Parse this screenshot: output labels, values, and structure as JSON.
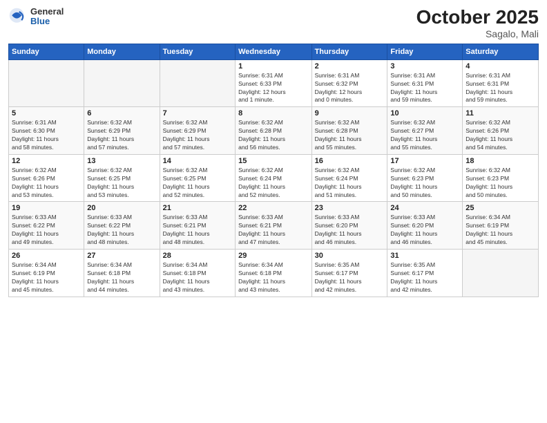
{
  "header": {
    "logo_general": "General",
    "logo_blue": "Blue",
    "month_title": "October 2025",
    "location": "Sagalo, Mali"
  },
  "weekdays": [
    "Sunday",
    "Monday",
    "Tuesday",
    "Wednesday",
    "Thursday",
    "Friday",
    "Saturday"
  ],
  "weeks": [
    [
      {
        "day": "",
        "info": ""
      },
      {
        "day": "",
        "info": ""
      },
      {
        "day": "",
        "info": ""
      },
      {
        "day": "1",
        "info": "Sunrise: 6:31 AM\nSunset: 6:33 PM\nDaylight: 12 hours\nand 1 minute."
      },
      {
        "day": "2",
        "info": "Sunrise: 6:31 AM\nSunset: 6:32 PM\nDaylight: 12 hours\nand 0 minutes."
      },
      {
        "day": "3",
        "info": "Sunrise: 6:31 AM\nSunset: 6:31 PM\nDaylight: 11 hours\nand 59 minutes."
      },
      {
        "day": "4",
        "info": "Sunrise: 6:31 AM\nSunset: 6:31 PM\nDaylight: 11 hours\nand 59 minutes."
      }
    ],
    [
      {
        "day": "5",
        "info": "Sunrise: 6:31 AM\nSunset: 6:30 PM\nDaylight: 11 hours\nand 58 minutes."
      },
      {
        "day": "6",
        "info": "Sunrise: 6:32 AM\nSunset: 6:29 PM\nDaylight: 11 hours\nand 57 minutes."
      },
      {
        "day": "7",
        "info": "Sunrise: 6:32 AM\nSunset: 6:29 PM\nDaylight: 11 hours\nand 57 minutes."
      },
      {
        "day": "8",
        "info": "Sunrise: 6:32 AM\nSunset: 6:28 PM\nDaylight: 11 hours\nand 56 minutes."
      },
      {
        "day": "9",
        "info": "Sunrise: 6:32 AM\nSunset: 6:28 PM\nDaylight: 11 hours\nand 55 minutes."
      },
      {
        "day": "10",
        "info": "Sunrise: 6:32 AM\nSunset: 6:27 PM\nDaylight: 11 hours\nand 55 minutes."
      },
      {
        "day": "11",
        "info": "Sunrise: 6:32 AM\nSunset: 6:26 PM\nDaylight: 11 hours\nand 54 minutes."
      }
    ],
    [
      {
        "day": "12",
        "info": "Sunrise: 6:32 AM\nSunset: 6:26 PM\nDaylight: 11 hours\nand 53 minutes."
      },
      {
        "day": "13",
        "info": "Sunrise: 6:32 AM\nSunset: 6:25 PM\nDaylight: 11 hours\nand 53 minutes."
      },
      {
        "day": "14",
        "info": "Sunrise: 6:32 AM\nSunset: 6:25 PM\nDaylight: 11 hours\nand 52 minutes."
      },
      {
        "day": "15",
        "info": "Sunrise: 6:32 AM\nSunset: 6:24 PM\nDaylight: 11 hours\nand 52 minutes."
      },
      {
        "day": "16",
        "info": "Sunrise: 6:32 AM\nSunset: 6:24 PM\nDaylight: 11 hours\nand 51 minutes."
      },
      {
        "day": "17",
        "info": "Sunrise: 6:32 AM\nSunset: 6:23 PM\nDaylight: 11 hours\nand 50 minutes."
      },
      {
        "day": "18",
        "info": "Sunrise: 6:32 AM\nSunset: 6:23 PM\nDaylight: 11 hours\nand 50 minutes."
      }
    ],
    [
      {
        "day": "19",
        "info": "Sunrise: 6:33 AM\nSunset: 6:22 PM\nDaylight: 11 hours\nand 49 minutes."
      },
      {
        "day": "20",
        "info": "Sunrise: 6:33 AM\nSunset: 6:22 PM\nDaylight: 11 hours\nand 48 minutes."
      },
      {
        "day": "21",
        "info": "Sunrise: 6:33 AM\nSunset: 6:21 PM\nDaylight: 11 hours\nand 48 minutes."
      },
      {
        "day": "22",
        "info": "Sunrise: 6:33 AM\nSunset: 6:21 PM\nDaylight: 11 hours\nand 47 minutes."
      },
      {
        "day": "23",
        "info": "Sunrise: 6:33 AM\nSunset: 6:20 PM\nDaylight: 11 hours\nand 46 minutes."
      },
      {
        "day": "24",
        "info": "Sunrise: 6:33 AM\nSunset: 6:20 PM\nDaylight: 11 hours\nand 46 minutes."
      },
      {
        "day": "25",
        "info": "Sunrise: 6:34 AM\nSunset: 6:19 PM\nDaylight: 11 hours\nand 45 minutes."
      }
    ],
    [
      {
        "day": "26",
        "info": "Sunrise: 6:34 AM\nSunset: 6:19 PM\nDaylight: 11 hours\nand 45 minutes."
      },
      {
        "day": "27",
        "info": "Sunrise: 6:34 AM\nSunset: 6:18 PM\nDaylight: 11 hours\nand 44 minutes."
      },
      {
        "day": "28",
        "info": "Sunrise: 6:34 AM\nSunset: 6:18 PM\nDaylight: 11 hours\nand 43 minutes."
      },
      {
        "day": "29",
        "info": "Sunrise: 6:34 AM\nSunset: 6:18 PM\nDaylight: 11 hours\nand 43 minutes."
      },
      {
        "day": "30",
        "info": "Sunrise: 6:35 AM\nSunset: 6:17 PM\nDaylight: 11 hours\nand 42 minutes."
      },
      {
        "day": "31",
        "info": "Sunrise: 6:35 AM\nSunset: 6:17 PM\nDaylight: 11 hours\nand 42 minutes."
      },
      {
        "day": "",
        "info": ""
      }
    ]
  ]
}
